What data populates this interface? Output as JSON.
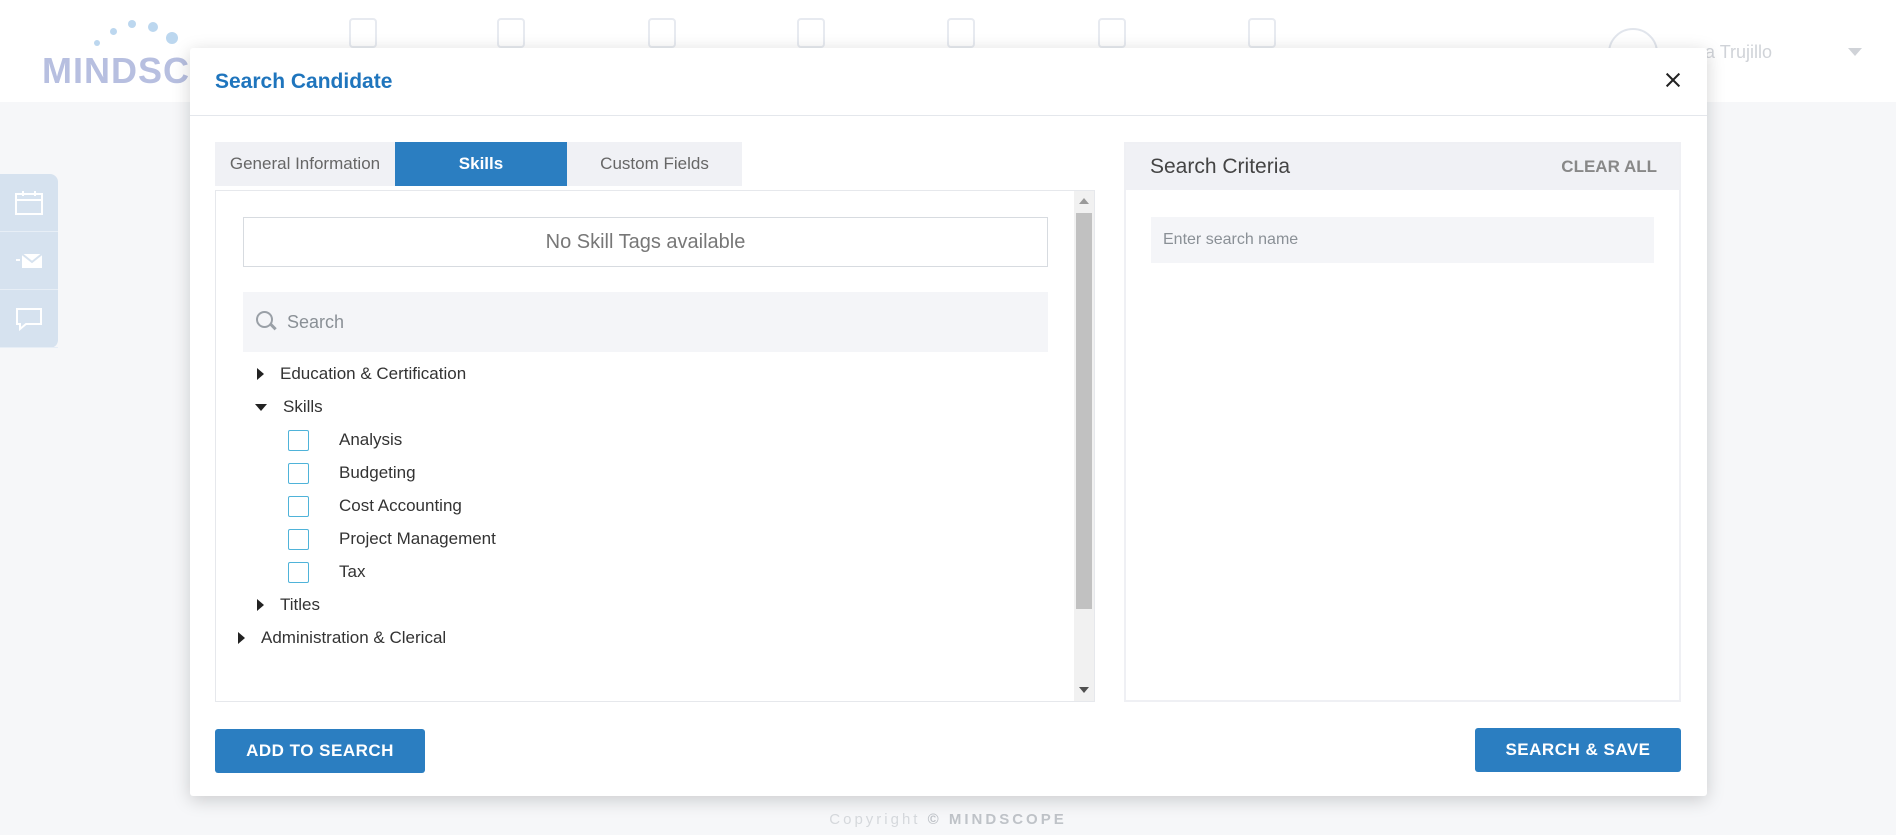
{
  "background": {
    "logo_text": "MINDSCO",
    "user_name": "ua Trujillo",
    "copyright_prefix": "Copyright ",
    "copyright_brand": "© MINDSCOPE",
    "side_tabs": [
      "calendar-icon",
      "email-icon",
      "sms-icon"
    ]
  },
  "modal": {
    "title": "Search Candidate",
    "tabs": [
      {
        "label": "General Information",
        "active": false
      },
      {
        "label": "Skills",
        "active": true
      },
      {
        "label": "Custom Fields",
        "active": false
      }
    ],
    "no_tags_text": "No Skill Tags available",
    "search_placeholder": "Search",
    "tree": [
      {
        "label": "Education & Certification",
        "expanded": false,
        "type": "group"
      },
      {
        "label": "Skills",
        "expanded": true,
        "type": "group"
      },
      {
        "label": "Analysis",
        "type": "item",
        "checked": false
      },
      {
        "label": "Budgeting",
        "type": "item",
        "checked": false
      },
      {
        "label": "Cost Accounting",
        "type": "item",
        "checked": false
      },
      {
        "label": "Project Management",
        "type": "item",
        "checked": false
      },
      {
        "label": "Tax",
        "type": "item",
        "checked": false
      },
      {
        "label": "Titles",
        "expanded": false,
        "type": "group"
      },
      {
        "label": "Administration & Clerical",
        "expanded": false,
        "type": "category"
      }
    ],
    "criteria": {
      "title": "Search Criteria",
      "clear_all": "CLEAR ALL",
      "name_placeholder": "Enter search name"
    },
    "buttons": {
      "add_to_search": "ADD TO SEARCH",
      "search_and_save": "SEARCH & SAVE"
    }
  },
  "colors": {
    "accent": "#2b7ec1",
    "title": "#1f75bd",
    "checkbox_border": "#4fb3d9"
  }
}
